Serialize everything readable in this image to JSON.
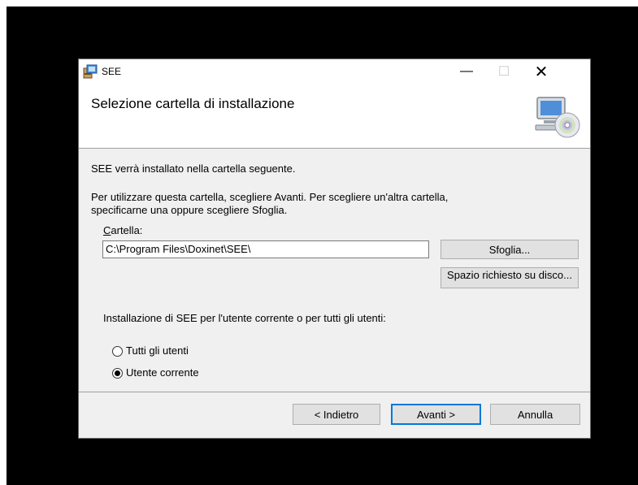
{
  "window": {
    "title": "SEE",
    "controls": {
      "minimize": "—",
      "maximize": "☐",
      "close": "✕"
    }
  },
  "banner": {
    "title": "Selezione cartella di installazione"
  },
  "body": {
    "intro": "SEE verrà installato nella cartella seguente.",
    "instruction_line1": "Per utilizzare questa cartella, scegliere Avanti. Per scegliere un'altra cartella,",
    "instruction_line2": "specificarne una oppure scegliere Sfoglia.",
    "folder_label_accel": "C",
    "folder_label_rest": "artella:",
    "folder_value": "C:\\Program Files\\Doxinet\\SEE\\",
    "browse_button": "Sfoglia...",
    "disk_space_button": "Spazio richiesto su disco...",
    "scope_question": "Installazione di SEE per l'utente corrente o per tutti gli utenti:",
    "radio_options": [
      {
        "label": "Tutti gli utenti",
        "selected": false
      },
      {
        "label": "Utente corrente",
        "selected": true
      }
    ]
  },
  "footer": {
    "back_button": "< Indietro",
    "next_button": "Avanti >",
    "cancel_button": "Annulla"
  },
  "colors": {
    "accent": "#0078d7",
    "background": "#f0f0f0",
    "screen": "#000000"
  }
}
